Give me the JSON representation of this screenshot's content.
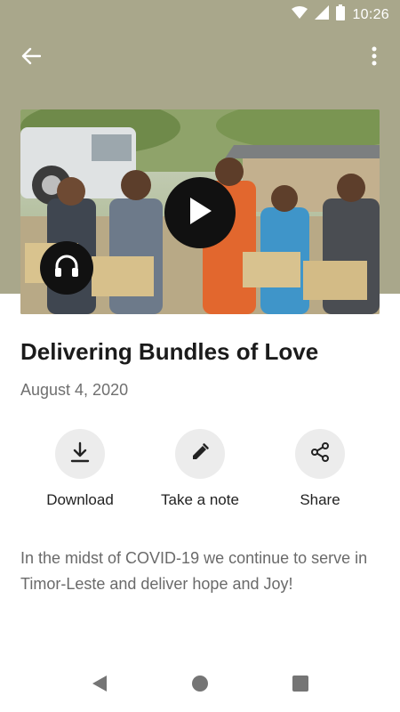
{
  "status_bar": {
    "time": "10:26"
  },
  "header": {
    "background_color": "#a9a78b"
  },
  "media": {
    "play_icon": "play-icon",
    "audio_icon": "headphones-icon"
  },
  "post": {
    "title": "Delivering Bundles of Love",
    "date": "August 4, 2020",
    "description": "In the midst of COVID-19 we continue to serve in Timor-Leste and deliver hope and Joy!"
  },
  "actions": [
    {
      "label": "Download",
      "icon": "download-icon"
    },
    {
      "label": "Take a note",
      "icon": "pencil-icon"
    },
    {
      "label": "Share",
      "icon": "share-icon"
    }
  ],
  "navigation": {
    "icons": [
      "back-triangle-icon",
      "home-circle-icon",
      "recents-square-icon"
    ]
  }
}
